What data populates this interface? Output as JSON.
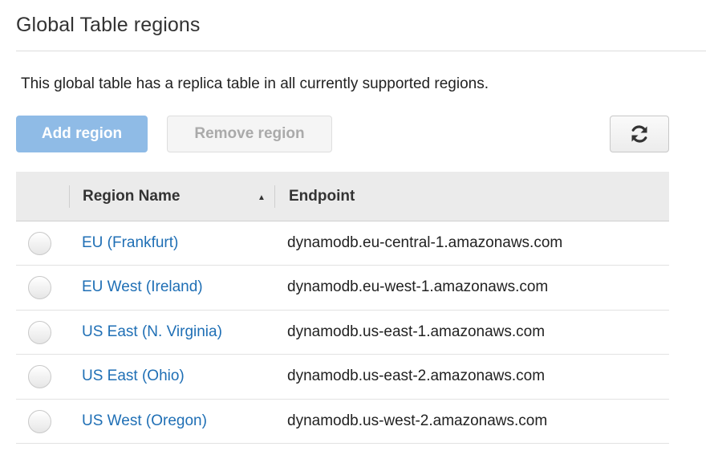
{
  "section": {
    "title": "Global Table regions",
    "description": "This global table has a replica table in all currently supported regions."
  },
  "toolbar": {
    "add_label": "Add region",
    "remove_label": "Remove region",
    "refresh_icon": "refresh-icon",
    "add_color": "#8fbbe6"
  },
  "table": {
    "columns": [
      "Region Name",
      "Endpoint"
    ],
    "sort": {
      "column": "Region Name",
      "direction": "ascending"
    },
    "rows": [
      {
        "region": "EU (Frankfurt)",
        "endpoint": "dynamodb.eu-central-1.amazonaws.com"
      },
      {
        "region": "EU West (Ireland)",
        "endpoint": "dynamodb.eu-west-1.amazonaws.com"
      },
      {
        "region": "US East (N. Virginia)",
        "endpoint": "dynamodb.us-east-1.amazonaws.com"
      },
      {
        "region": "US East (Ohio)",
        "endpoint": "dynamodb.us-east-2.amazonaws.com"
      },
      {
        "region": "US West (Oregon)",
        "endpoint": "dynamodb.us-west-2.amazonaws.com"
      }
    ],
    "link_color": "#1f6fb5"
  }
}
